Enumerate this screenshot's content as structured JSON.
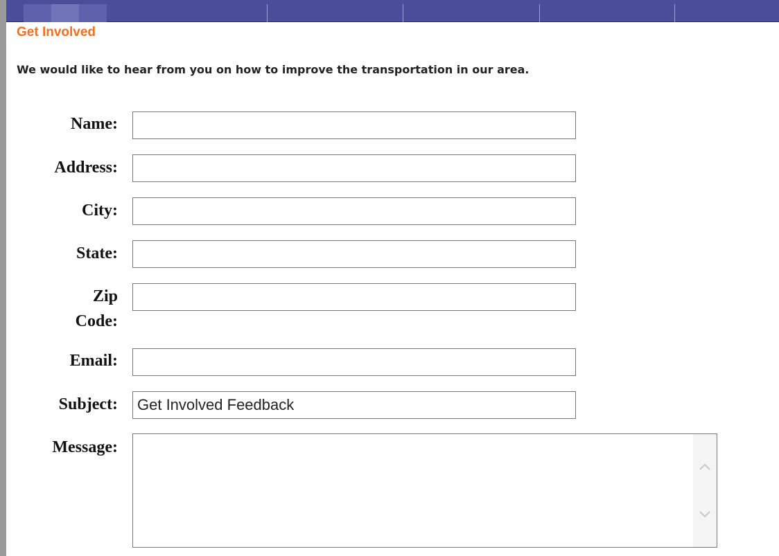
{
  "heading": "Get Involved",
  "intro": "We would like to hear from you on how to improve the transportation in our area.",
  "form": {
    "name_label": "Name:",
    "name_value": "",
    "address_label": "Address:",
    "address_value": "",
    "city_label": "City:",
    "city_value": "",
    "state_label": "State:",
    "state_value": "",
    "zip_label_line1": "Zip",
    "zip_label_line2": "Code:",
    "zip_value": "",
    "email_label": "Email:",
    "email_value": "",
    "subject_label": "Subject:",
    "subject_value": "Get Involved Feedback",
    "message_label": "Message:",
    "message_value": ""
  },
  "colors": {
    "nav_bar": "#4a4d99",
    "heading": "#f36f21",
    "left_border": "#9a9a9a"
  },
  "icons": {
    "scroll_up": "chevron-up-icon",
    "scroll_down": "chevron-down-icon"
  }
}
